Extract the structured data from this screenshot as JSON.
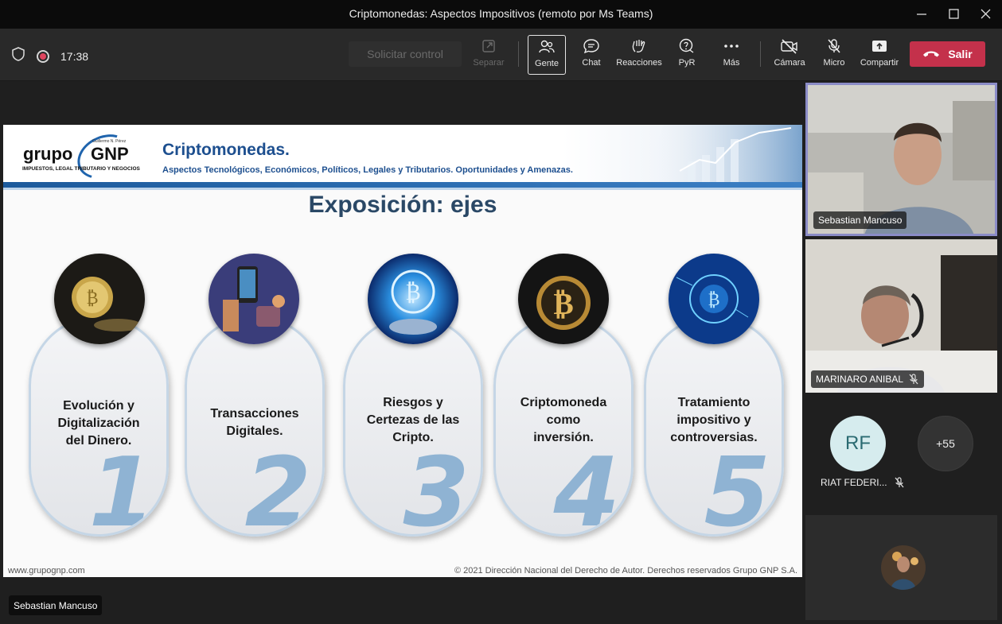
{
  "window": {
    "title": "Criptomonedas: Aspectos Impositivos (remoto por Ms Teams)"
  },
  "toolbar": {
    "time": "17:38",
    "request_control": "Solicitar control",
    "buttons": {
      "separar": "Separar",
      "gente": "Gente",
      "chat": "Chat",
      "reacciones": "Reacciones",
      "pyr": "PyR",
      "mas": "Más",
      "camara": "Cámara",
      "micro": "Micro",
      "compartir": "Compartir"
    },
    "leave": "Salir",
    "leave_color": "#c4314b"
  },
  "slide": {
    "logo_grupo": "grupo",
    "logo_gnp": "GNP",
    "logo_fine": "Guillermo N. Pérez",
    "logo_tagline": "IMPUESTOS, LEGAL TRIBUTARIO Y NEGOCIOS",
    "header_title": "Criptomonedas.",
    "header_subtitle": "Aspectos Tecnológicos, Económicos, Políticos, Legales y Tributarios. Oportunidades y Amenazas.",
    "title": "Exposición: ejes",
    "axes": [
      {
        "number": "1",
        "text": "Evolución y\nDigitalización\ndel Dinero.",
        "image": "gold-bitcoin-coin"
      },
      {
        "number": "2",
        "text": "Transacciones\nDigitales.",
        "image": "phone-coins-wallet"
      },
      {
        "number": "3",
        "text": "Riesgos y\nCertezas de las\nCripto.",
        "image": "glowing-blue-bitcoin"
      },
      {
        "number": "4",
        "text": "Criptomoneda\ncomo\ninversión.",
        "image": "golden-bitcoin-dark"
      },
      {
        "number": "5",
        "text": "Tratamiento\nimpositivo y\ncontroversias.",
        "image": "digital-bitcoin-network"
      }
    ],
    "footer_left": "www.grupognp.com",
    "footer_right": "© 2021 Dirección Nacional del Derecho de Autor. Derechos reservados Grupo GNP S.A."
  },
  "presenter": {
    "name": "Sebastian Mancuso"
  },
  "participants": {
    "tile1": {
      "name": "Sebastian Mancuso"
    },
    "tile2": {
      "name": "MARINARO ANIBAL"
    },
    "rf": {
      "initials": "RF",
      "name": "RIAT FEDERI..."
    },
    "overflow": "+55"
  }
}
